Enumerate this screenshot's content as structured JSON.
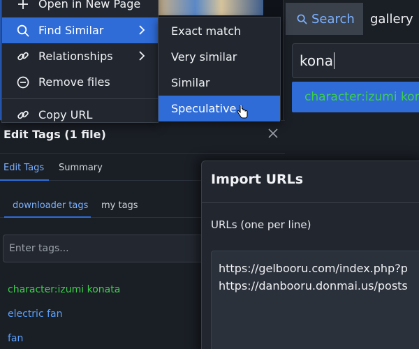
{
  "context_menu": {
    "items": [
      {
        "label": "Open in New Page",
        "icon": "plus-icon"
      },
      {
        "label": "Find Similar",
        "icon": "search-icon"
      },
      {
        "label": "Relationships",
        "icon": "link-icon"
      },
      {
        "label": "Remove files",
        "icon": "minus-circle-icon"
      },
      {
        "label": "Copy URL",
        "icon": "link-icon"
      }
    ],
    "submenu": [
      "Exact match",
      "Very similar",
      "Similar",
      "Speculative"
    ]
  },
  "search": {
    "tabs": {
      "search": "Search",
      "gallery": "gallery"
    },
    "query": "kona",
    "suggestion": "character:izumi konata"
  },
  "edit_tags": {
    "title": "Edit Tags (1 file)",
    "tabs": [
      "Edit Tags",
      "Summary"
    ],
    "subtabs": [
      "downloader tags",
      "my tags"
    ],
    "input_placeholder": "Enter tags...",
    "tags": [
      {
        "text": "character:izumi konata",
        "color": "#3ecf4d"
      },
      {
        "text": "electric fan",
        "color": "#5aa2ff"
      },
      {
        "text": "fan",
        "color": "#5aa2ff"
      }
    ]
  },
  "import_urls": {
    "title": "Import URLs",
    "label": "URLs (one per line)",
    "lines": [
      "https://gelbooru.com/index.php?p",
      "https://danbooru.donmai.us/posts"
    ]
  },
  "colors": {
    "accent": "#2f6cd8",
    "link": "#5aa2ff",
    "character": "#3ecf4d"
  }
}
